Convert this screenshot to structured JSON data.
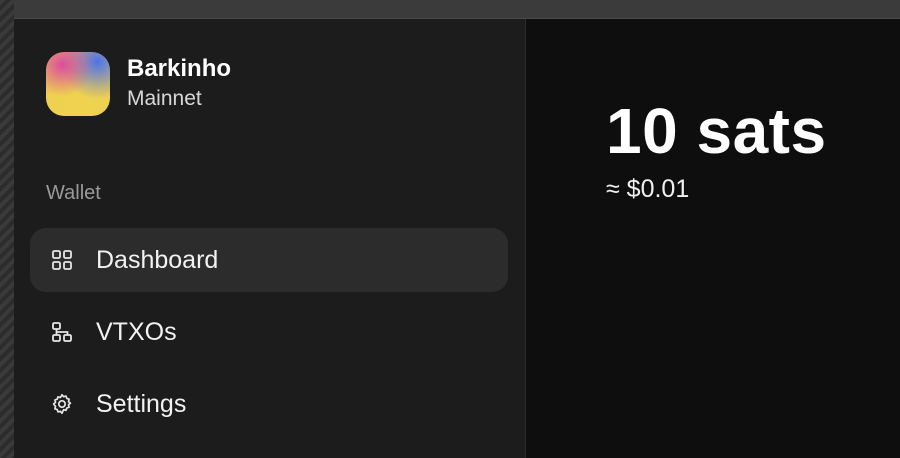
{
  "account": {
    "name": "Barkinho",
    "network": "Mainnet"
  },
  "sidebar": {
    "section_label": "Wallet",
    "items": [
      {
        "label": "Dashboard",
        "icon": "grid-icon",
        "active": true
      },
      {
        "label": "VTXOs",
        "icon": "tree-icon",
        "active": false
      },
      {
        "label": "Settings",
        "icon": "gear-icon",
        "active": false
      }
    ]
  },
  "balance": {
    "amount": "10 sats",
    "fiat": "≈ $0.01"
  },
  "colors": {
    "sidebar_bg": "#1c1c1c",
    "main_bg": "#0e0e0e",
    "active_item_bg": "#2c2c2c"
  }
}
